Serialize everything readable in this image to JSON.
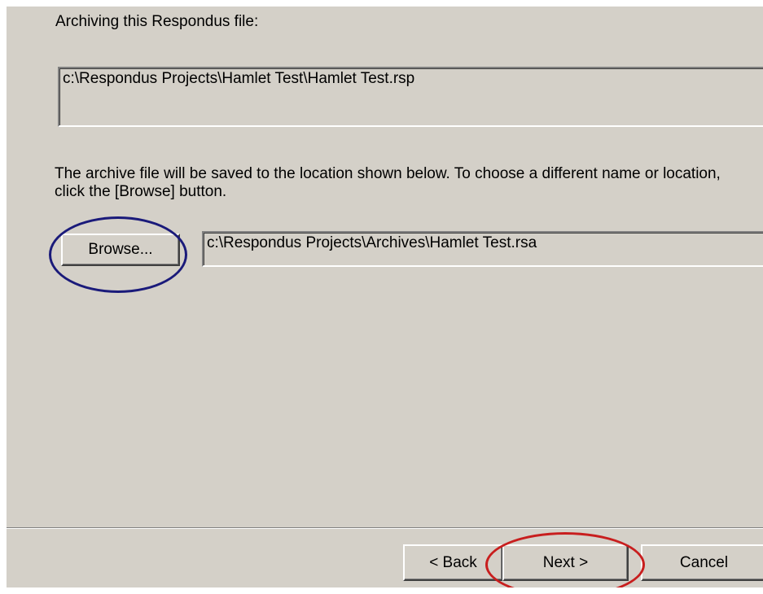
{
  "dialog": {
    "source_label": "Archiving this Respondus file:",
    "source_path": "c:\\Respondus Projects\\Hamlet Test\\Hamlet Test.rsp",
    "description": "The archive file will be saved to the location shown below.  To choose a different name or location, click the [Browse] button.",
    "browse_label": "Browse...",
    "destination_path": "c:\\Respondus Projects\\Archives\\Hamlet Test.rsa"
  },
  "footer": {
    "back_label": "< Back",
    "next_label": "Next >",
    "cancel_label": "Cancel"
  },
  "annotations": {
    "browse_highlight_color": "#1a1a7a",
    "next_highlight_color": "#c81e1e"
  }
}
